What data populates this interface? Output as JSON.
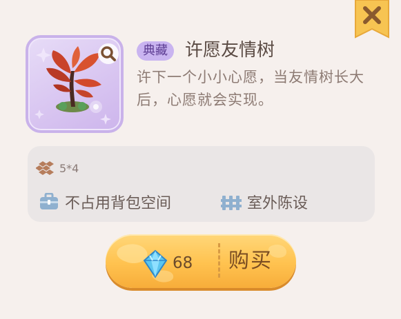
{
  "item": {
    "tag": "典藏",
    "name": "许愿友情树",
    "description": "许下一个小小心愿，当友情树长大后，心愿就会实现。"
  },
  "info": {
    "size": "5*4",
    "attribute_1": "不占用背包空间",
    "attribute_2": "室外陈设"
  },
  "buy": {
    "price": "68",
    "label": "购买",
    "currency_icon": "diamond-icon"
  },
  "colors": {
    "background": "#f6f0ed",
    "tag_bg": "#c9b4f0",
    "button": "#ffc24f",
    "panel": "#eae6e6"
  }
}
